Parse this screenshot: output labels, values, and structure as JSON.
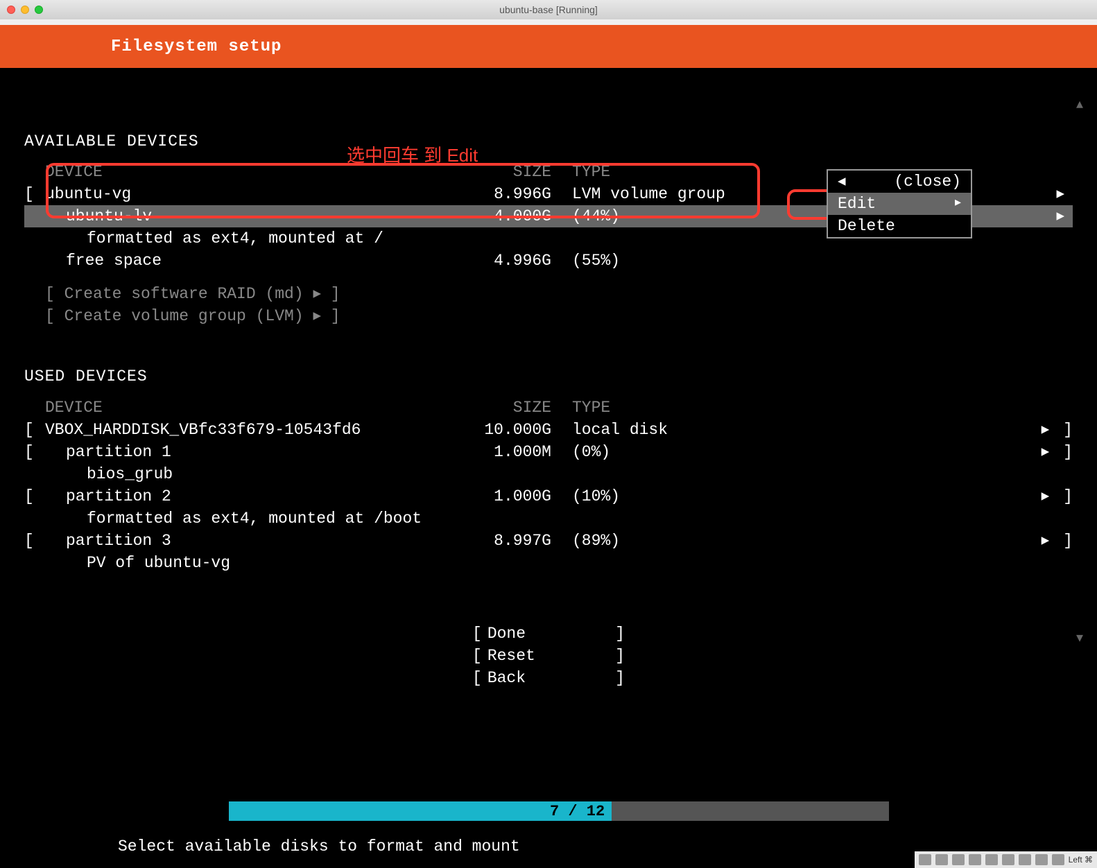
{
  "window": {
    "title": "ubuntu-base [Running]"
  },
  "header": {
    "title": "Filesystem setup"
  },
  "annotation": {
    "text": "选中回车 到 Edit"
  },
  "available": {
    "title": "AVAILABLE DEVICES",
    "columns": {
      "device": "DEVICE",
      "size": "SIZE",
      "type": "TYPE"
    },
    "rows": [
      {
        "bracket": "[",
        "device": "ubuntu-vg",
        "size": "8.996G",
        "type": "LVM volume group",
        "arrow": "▸",
        "rbracket": "]"
      },
      {
        "bracket": "",
        "device": "ubuntu-lv",
        "size": "4.000G",
        "type": "(44%)",
        "arrow": "▸",
        "rbracket": "",
        "selected": true,
        "indent": 1
      },
      {
        "bracket": "",
        "device": "formatted as ext4, mounted at /",
        "size": "",
        "type": "",
        "arrow": "",
        "rbracket": "",
        "indent": 2
      },
      {
        "bracket": "",
        "device": "free space",
        "size": "4.996G",
        "type": "(55%)",
        "arrow": "",
        "rbracket": "",
        "indent": 1
      }
    ],
    "create_raid": "[ Create software RAID (md) ▸ ]",
    "create_lvm": "[ Create volume group (LVM) ▸ ]"
  },
  "used": {
    "title": "USED DEVICES",
    "columns": {
      "device": "DEVICE",
      "size": "SIZE",
      "type": "TYPE"
    },
    "rows": [
      {
        "bracket": "[",
        "device": "VBOX_HARDDISK_VBfc33f679-10543fd6",
        "size": "10.000G",
        "type": "local disk",
        "arrow": "▸",
        "rbracket": "]"
      },
      {
        "bracket": "[",
        "device": "partition 1",
        "size": "1.000M",
        "type": "(0%)",
        "arrow": "▸",
        "rbracket": "]",
        "indent": 1
      },
      {
        "bracket": "",
        "device": "bios_grub",
        "size": "",
        "type": "",
        "arrow": "",
        "rbracket": "",
        "indent": 2
      },
      {
        "bracket": "[",
        "device": "partition 2",
        "size": "1.000G",
        "type": "(10%)",
        "arrow": "▸",
        "rbracket": "]",
        "indent": 1
      },
      {
        "bracket": "",
        "device": "formatted as ext4, mounted at /boot",
        "size": "",
        "type": "",
        "arrow": "",
        "rbracket": "",
        "indent": 2
      },
      {
        "bracket": "[",
        "device": "partition 3",
        "size": "8.997G",
        "type": "(89%)",
        "arrow": "▸",
        "rbracket": "]",
        "indent": 1
      },
      {
        "bracket": "",
        "device": "PV of ubuntu-vg",
        "size": "",
        "type": "",
        "arrow": "",
        "rbracket": "",
        "indent": 2
      }
    ]
  },
  "popup": {
    "close": "(close)",
    "edit": "Edit",
    "delete": "Delete"
  },
  "footer": {
    "done": "Done",
    "reset": "Reset",
    "back": "Back"
  },
  "progress": {
    "label": "7 / 12"
  },
  "hint": "Select available disks to format and mount",
  "taskbar": {
    "label": "Left ⌘"
  }
}
